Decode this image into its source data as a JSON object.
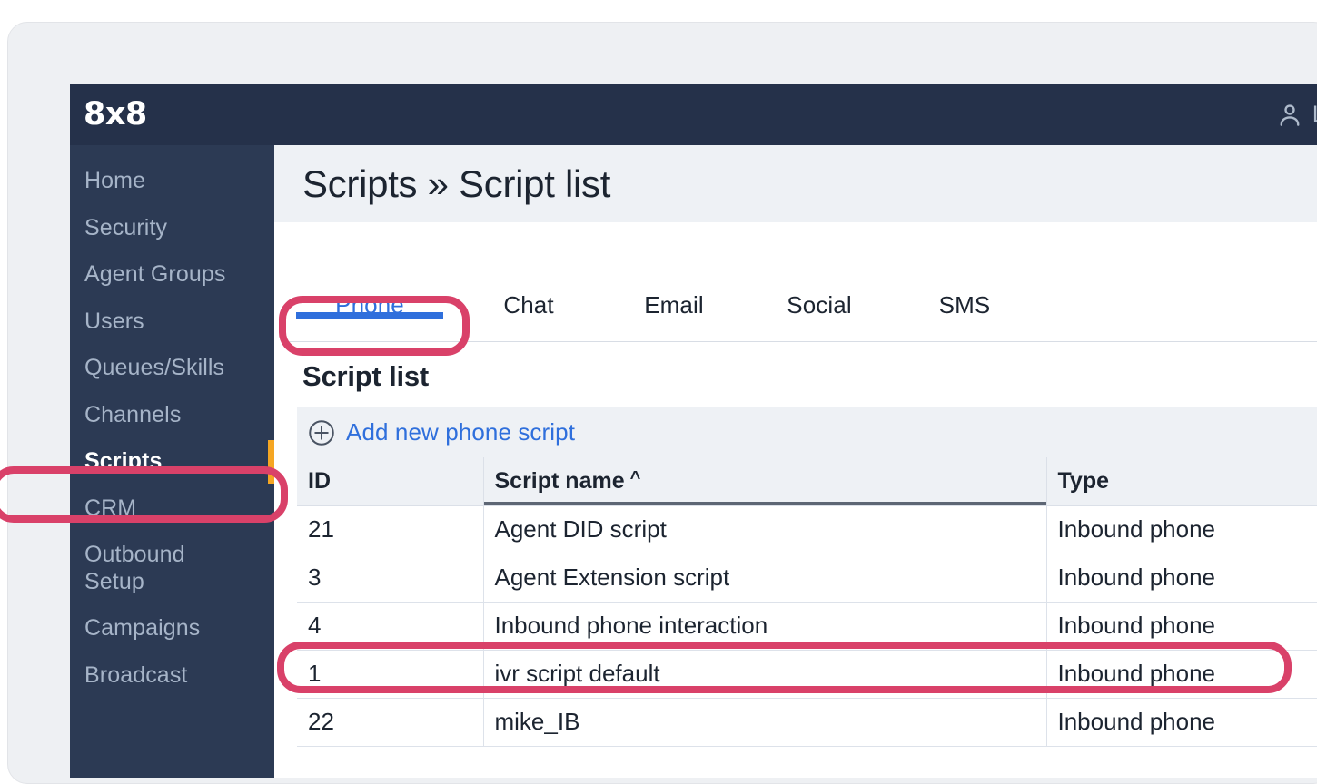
{
  "topbar": {
    "brand": "8x8",
    "user_icon": "user-icon",
    "logout_label": "L"
  },
  "sidebar": {
    "items": [
      {
        "label": "Home",
        "active": false
      },
      {
        "label": "Security",
        "active": false
      },
      {
        "label": "Agent Groups",
        "active": false
      },
      {
        "label": "Users",
        "active": false
      },
      {
        "label": "Queues/Skills",
        "active": false
      },
      {
        "label": "Channels",
        "active": false
      },
      {
        "label": "Scripts",
        "active": true
      },
      {
        "label": "CRM",
        "active": false
      },
      {
        "label": "Outbound\nSetup",
        "active": false
      },
      {
        "label": "Campaigns",
        "active": false
      },
      {
        "label": "Broadcast",
        "active": false
      }
    ]
  },
  "page": {
    "title": "Scripts » Script list",
    "section_title": "Script list"
  },
  "tabs": [
    {
      "label": "Phone",
      "active": true
    },
    {
      "label": "Chat",
      "active": false
    },
    {
      "label": "Email",
      "active": false
    },
    {
      "label": "Social",
      "active": false
    },
    {
      "label": "SMS",
      "active": false
    }
  ],
  "toolbar": {
    "add_icon": "circle-plus-icon",
    "add_label": "Add new phone script"
  },
  "table": {
    "columns": [
      {
        "key": "id",
        "label": "ID",
        "sorted": false
      },
      {
        "key": "name",
        "label": "Script name",
        "sorted": true,
        "sort_caret": "^"
      },
      {
        "key": "type",
        "label": "Type",
        "sorted": false
      }
    ],
    "rows": [
      {
        "id": "21",
        "name": "Agent DID script",
        "type": "Inbound phone",
        "highlighted": false
      },
      {
        "id": "3",
        "name": "Agent Extension script",
        "type": "Inbound phone",
        "highlighted": false
      },
      {
        "id": "4",
        "name": "Inbound phone interaction",
        "type": "Inbound phone",
        "highlighted": true
      },
      {
        "id": "1",
        "name": "ivr script default",
        "type": "Inbound phone",
        "highlighted": false
      },
      {
        "id": "22",
        "name": "mike_IB",
        "type": "Inbound phone",
        "highlighted": false
      }
    ]
  },
  "annotations": {
    "color": "#d94169",
    "targets": [
      "tab-phone",
      "sidebar-item-scripts",
      "table-row-inbound-phone-interaction"
    ]
  },
  "colors": {
    "topbar_bg": "#25314a",
    "sidebar_bg": "#2c3a54",
    "sidebar_active_text": "#ffffff",
    "sidebar_active_marker": "#f5a623",
    "sidebar_text": "#a6b4c8",
    "accent_blue": "#2f6fdc",
    "header_band": "#eef1f5",
    "annotation_pink": "#d94169"
  }
}
